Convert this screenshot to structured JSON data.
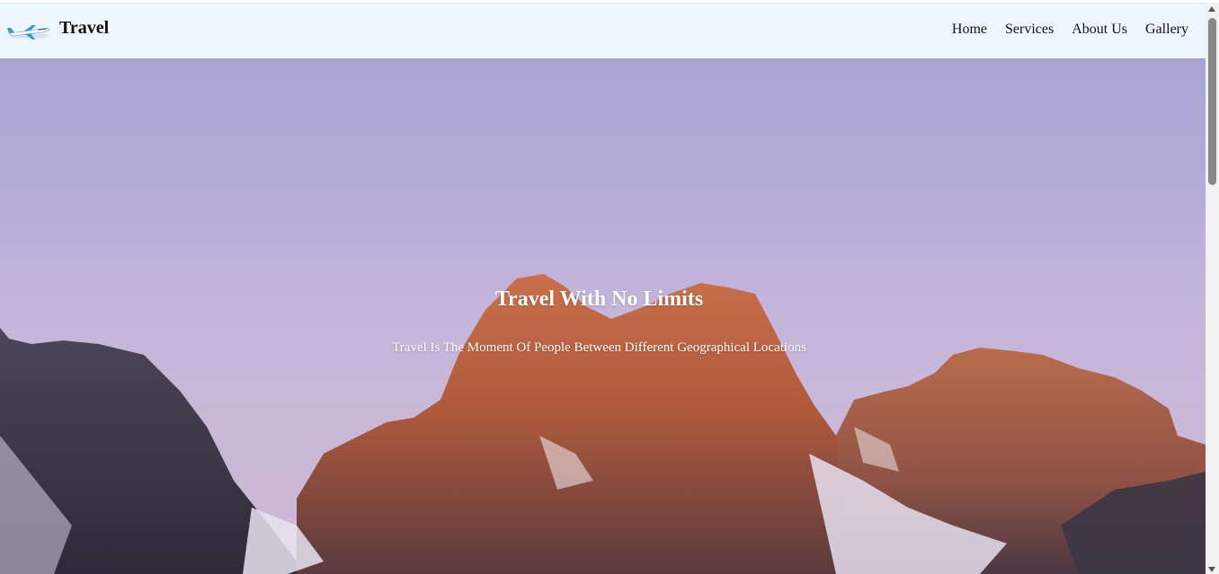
{
  "header": {
    "brand": "Travel",
    "logo_icon": "airplane-icon",
    "nav": [
      {
        "label": "Home"
      },
      {
        "label": "Services"
      },
      {
        "label": "About Us"
      },
      {
        "label": "Gallery"
      }
    ]
  },
  "hero": {
    "title": "Travel With No Limits",
    "subtitle": "Travel Is The Moment Of People Between Different Geographical Locations"
  },
  "colors": {
    "navbar_bg": "#eef6ff",
    "sky_top": "#a9a4d4",
    "sky_bottom": "#cdb9d6",
    "hero_text": "#ffffff"
  }
}
